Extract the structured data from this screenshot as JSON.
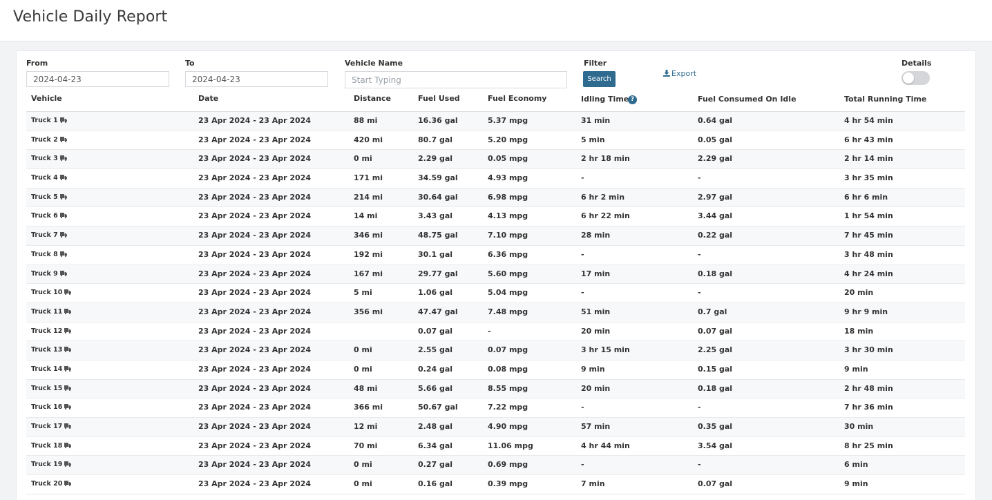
{
  "page": {
    "title": "Vehicle Daily Report"
  },
  "filters": {
    "from_label": "From",
    "from_value": "2024-04-23",
    "to_label": "To",
    "to_value": "2024-04-23",
    "vehicle_label": "Vehicle Name",
    "vehicle_placeholder": "Start Typing",
    "filter_label": "Filter",
    "search_label": "Search",
    "export_label": "Export",
    "details_label": "Details",
    "details_on": false
  },
  "columns": {
    "vehicle": "Vehicle",
    "date": "Date",
    "distance": "Distance",
    "fuel_used": "Fuel Used",
    "fuel_economy": "Fuel Economy",
    "idling_time": "Idling Time",
    "fuel_idle": "Fuel Consumed On Idle",
    "running_time": "Total Running Time"
  },
  "icons": {
    "help": "help-icon",
    "truck": "truck-icon",
    "export": "download-icon"
  },
  "accent_color": "#2f6a8f",
  "rows": [
    {
      "vehicle": "Truck 1",
      "date": "23 Apr 2024 - 23 Apr 2024",
      "distance": "88 mi",
      "fuel": "16.36 gal",
      "economy": "5.37 mpg",
      "idle": "31 min",
      "fuel_idle": "0.64 gal",
      "running": "4 hr 54 min"
    },
    {
      "vehicle": "Truck 2",
      "date": "23 Apr 2024 - 23 Apr 2024",
      "distance": "420 mi",
      "fuel": "80.7 gal",
      "economy": "5.20 mpg",
      "idle": "5 min",
      "fuel_idle": "0.05 gal",
      "running": "6 hr 43 min"
    },
    {
      "vehicle": "Truck 3",
      "date": "23 Apr 2024 - 23 Apr 2024",
      "distance": "0 mi",
      "fuel": "2.29 gal",
      "economy": "0.05 mpg",
      "idle": "2 hr 18 min",
      "fuel_idle": "2.29 gal",
      "running": "2 hr 14 min"
    },
    {
      "vehicle": "Truck 4",
      "date": "23 Apr 2024 - 23 Apr 2024",
      "distance": "171 mi",
      "fuel": "34.59 gal",
      "economy": "4.93 mpg",
      "idle": "-",
      "fuel_idle": "-",
      "running": "3 hr 35 min"
    },
    {
      "vehicle": "Truck 5",
      "date": "23 Apr 2024 - 23 Apr 2024",
      "distance": "214 mi",
      "fuel": "30.64 gal",
      "economy": "6.98 mpg",
      "idle": "6 hr 2 min",
      "fuel_idle": "2.97 gal",
      "running": "6 hr 6 min"
    },
    {
      "vehicle": "Truck 6",
      "date": "23 Apr 2024 - 23 Apr 2024",
      "distance": "14 mi",
      "fuel": "3.43 gal",
      "economy": "4.13 mpg",
      "idle": "6 hr 22 min",
      "fuel_idle": "3.44 gal",
      "running": "1 hr 54 min"
    },
    {
      "vehicle": "Truck 7",
      "date": "23 Apr 2024 - 23 Apr 2024",
      "distance": "346 mi",
      "fuel": "48.75 gal",
      "economy": "7.10 mpg",
      "idle": "28 min",
      "fuel_idle": "0.22 gal",
      "running": "7 hr 45 min"
    },
    {
      "vehicle": "Truck 8",
      "date": "23 Apr 2024 - 23 Apr 2024",
      "distance": "192 mi",
      "fuel": "30.1 gal",
      "economy": "6.36 mpg",
      "idle": "-",
      "fuel_idle": "-",
      "running": "3 hr 48 min"
    },
    {
      "vehicle": "Truck 9",
      "date": "23 Apr 2024 - 23 Apr 2024",
      "distance": "167 mi",
      "fuel": "29.77 gal",
      "economy": "5.60 mpg",
      "idle": "17 min",
      "fuel_idle": "0.18 gal",
      "running": "4 hr 24 min"
    },
    {
      "vehicle": "Truck 10",
      "date": "23 Apr 2024 - 23 Apr 2024",
      "distance": "5 mi",
      "fuel": "1.06 gal",
      "economy": "5.04 mpg",
      "idle": "-",
      "fuel_idle": "-",
      "running": "20 min"
    },
    {
      "vehicle": "Truck 11",
      "date": "23 Apr 2024 - 23 Apr 2024",
      "distance": "356 mi",
      "fuel": "47.47 gal",
      "economy": "7.48 mpg",
      "idle": "51 min",
      "fuel_idle": "0.7 gal",
      "running": "9 hr 9 min"
    },
    {
      "vehicle": "Truck 12",
      "date": "23 Apr 2024 - 23 Apr 2024",
      "distance": "",
      "fuel": "0.07 gal",
      "economy": "-",
      "idle": "20 min",
      "fuel_idle": "0.07 gal",
      "running": "18 min"
    },
    {
      "vehicle": "Truck 13",
      "date": "23 Apr 2024 - 23 Apr 2024",
      "distance": "0 mi",
      "fuel": "2.55 gal",
      "economy": "0.07 mpg",
      "idle": "3 hr 15 min",
      "fuel_idle": "2.25 gal",
      "running": "3 hr 30 min"
    },
    {
      "vehicle": "Truck 14",
      "date": "23 Apr 2024 - 23 Apr 2024",
      "distance": "0 mi",
      "fuel": "0.24 gal",
      "economy": "0.08 mpg",
      "idle": "9 min",
      "fuel_idle": "0.15 gal",
      "running": "9 min"
    },
    {
      "vehicle": "Truck 15",
      "date": "23 Apr 2024 - 23 Apr 2024",
      "distance": "48 mi",
      "fuel": "5.66 gal",
      "economy": "8.55 mpg",
      "idle": "20 min",
      "fuel_idle": "0.18 gal",
      "running": "2 hr 48 min"
    },
    {
      "vehicle": "Truck 16",
      "date": "23 Apr 2024 - 23 Apr 2024",
      "distance": "366 mi",
      "fuel": "50.67 gal",
      "economy": "7.22 mpg",
      "idle": "-",
      "fuel_idle": "-",
      "running": "7 hr 36 min"
    },
    {
      "vehicle": "Truck 17",
      "date": "23 Apr 2024 - 23 Apr 2024",
      "distance": "12 mi",
      "fuel": "2.48 gal",
      "economy": "4.90 mpg",
      "idle": "57 min",
      "fuel_idle": "0.35 gal",
      "running": "30 min"
    },
    {
      "vehicle": "Truck 18",
      "date": "23 Apr 2024 - 23 Apr 2024",
      "distance": "70 mi",
      "fuel": "6.34 gal",
      "economy": "11.06 mpg",
      "idle": "4 hr 44 min",
      "fuel_idle": "3.54 gal",
      "running": "8 hr 25 min"
    },
    {
      "vehicle": "Truck 19",
      "date": "23 Apr 2024 - 23 Apr 2024",
      "distance": "0 mi",
      "fuel": "0.27 gal",
      "economy": "0.69 mpg",
      "idle": "-",
      "fuel_idle": "-",
      "running": "6 min"
    },
    {
      "vehicle": "Truck 20",
      "date": "23 Apr 2024 - 23 Apr 2024",
      "distance": "0 mi",
      "fuel": "0.16 gal",
      "economy": "0.39 mpg",
      "idle": "7 min",
      "fuel_idle": "0.07 gal",
      "running": "9 min"
    }
  ]
}
